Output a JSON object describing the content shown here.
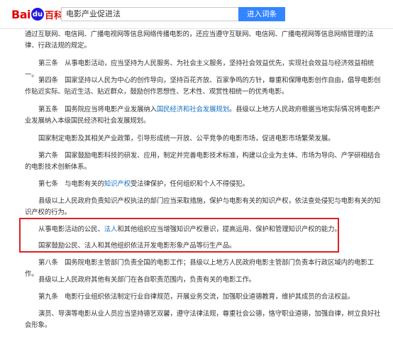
{
  "header": {
    "logo_left": "Bai",
    "logo_paw": "du",
    "logo_right": "百科",
    "search_value": "电影产业促进法",
    "search_button": "进入词条"
  },
  "paragraphs": [
    {
      "pre": "通过互联网、电信网、广播电视网等信息网络传播电影的，还应当遵守互联网、电信网、广播电视网等信息网络管理的法律、行政法规的规定。"
    },
    {
      "pre": "第三条　从事电影活动，应当坚持为人民服务、为社会主义服务，坚持社会效益优先，实现社会效益与经济效益相统一。"
    },
    {
      "pre": "第四条　国家坚持以人民为中心的创作导向，坚持百花齐放、百家争鸣的方针，尊重和保障电影创作自由，倡导电影创作贴近实际、贴近生活、贴近群众，鼓励创作思想性、艺术性、观赏性相统一的优秀电影。"
    },
    {
      "pre": "第五条　国务院应当将电影产业发展纳入",
      "link": "国民经济和社会发展规划",
      "post": "。县级以上地方人民政府根据当地实际情况将电影产业发展纳入本级国民经济和社会发展规划。"
    },
    {
      "pre": "国家制定电影及其相关产业政策，引导形成统一开放、公平竞争的电影市场，促进电影市场繁荣发展。"
    },
    {
      "pre": "第六条　国家鼓励电影科技的研发、应用，制定并完善电影技术标准，构建以企业为主体、市场为导向、产学研相结合的电影技术创新体系。"
    },
    {
      "pre": "第七条　与电影有关的",
      "link": "知识产权",
      "post": "受法律保护，任何组织和个人不得侵犯。"
    },
    {
      "pre": "县级以上人民政府负责知识产权执法的部门应当采取措施，保护与电影有关的知识产权，依法查处侵犯与电影有关的知识产权的行为。"
    },
    {
      "pre": "从事电影活动的公民、",
      "link": "法人",
      "post": "和其他组织应当增强知识产权意识，提高运用、保护和管理知识产权的能力。"
    },
    {
      "pre": "国家鼓励公民、法人和其他组织依法开发电影形象产品等衍生产品。"
    },
    {
      "pre": "第八条　国务院电影主管部门负责全国的电影工作；县级以上地方人民政府电影主管部门负责本行政区域内的电影工作。"
    },
    {
      "pre": "县级以上人民政府其他有关部门在各自职责范围内，负责有关的电影工作。"
    },
    {
      "pre": "第九条　电影行业组织依法制定行业自律规范，开展业务交流，加强职业道德教育，维护其成员的合法权益。"
    },
    {
      "pre": "演员、导演等电影从业人员应当坚持德艺双馨，遵守法律法规，尊重社会公德，恪守职业道德，加强自律，树立良好社会形象。"
    }
  ]
}
